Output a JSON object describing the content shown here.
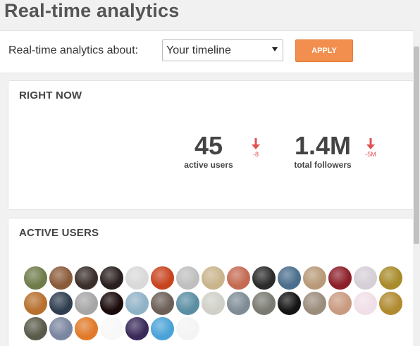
{
  "page": {
    "title": "Real-time analytics"
  },
  "filter": {
    "label": "Real-time analytics about:",
    "selected": "Your timeline",
    "apply_label": "APPLY"
  },
  "right_now": {
    "heading": "RIGHT NOW",
    "active_users": {
      "value": "45",
      "label": "active users",
      "delta": "-8"
    },
    "total_followers": {
      "value": "1.4M",
      "label": "total followers",
      "delta": "-5M"
    }
  },
  "active_users": {
    "heading": "ACTIVE USERS",
    "avatars": [
      "#6f7c4a",
      "#8a5b3a",
      "#3a2e2a",
      "#2a1f1f",
      "#d9d9d9",
      "#c8441f",
      "#bfbfbf",
      "#c9b48c",
      "#c46a52",
      "#2b2b2b",
      "#4a6e8c",
      "#b89a78",
      "#8c1f2a",
      "#d5cfd6",
      "#a88b2a",
      "#b8702e",
      "#2f3e4f",
      "#a6a6a6",
      "#1a0a0a",
      "#8fb2c7",
      "#6b5f57",
      "#5a8ea3",
      "#d0d0c8",
      "#7f8c96",
      "#7a7a72",
      "#141414",
      "#9c8c7c",
      "#c99a7f",
      "#f0dfe8",
      "#b08a30",
      "#5a5a4a",
      "#7a86a0",
      "#e07a2a",
      "#f8f8f8",
      "#3a2a5a",
      "#4aa3d8",
      "#f4f4f4"
    ]
  }
}
